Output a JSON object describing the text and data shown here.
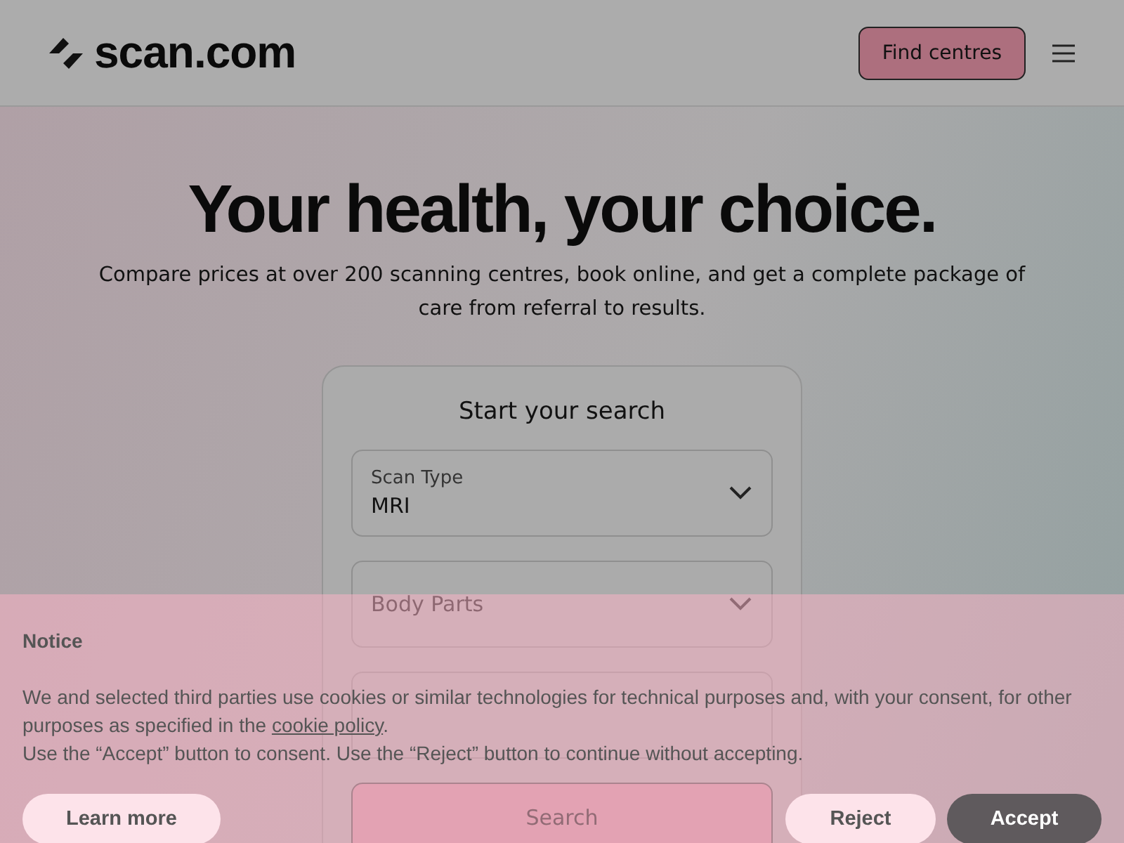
{
  "header": {
    "logo": "scan.com",
    "cta": "Find centres"
  },
  "hero": {
    "title": "Your health, your choice.",
    "subtitle": "Compare prices at over 200 scanning centres, book online, and get a complete package of care from referral to results."
  },
  "search_card": {
    "title": "Start your search",
    "fields": [
      {
        "kind": "select",
        "label": "Scan Type",
        "value": "MRI"
      },
      {
        "kind": "select",
        "placeholder": "Body Parts"
      },
      {
        "kind": "location"
      }
    ],
    "button": "Search"
  },
  "cookie_banner": {
    "title": "Notice",
    "text_before": "We and selected third parties use cookies or similar technologies for technical purposes and, with your consent, for other purposes as specified in the ",
    "link": "cookie policy",
    "text_after": ".",
    "text2": "Use the “Accept” button to consent. Use the “Reject” button to continue without accepting.",
    "buttons": [
      {
        "label": "Learn more",
        "kind": "secondary"
      },
      {
        "label": "Reject",
        "kind": "secondary"
      },
      {
        "label": "Accept",
        "kind": "primary"
      }
    ]
  }
}
